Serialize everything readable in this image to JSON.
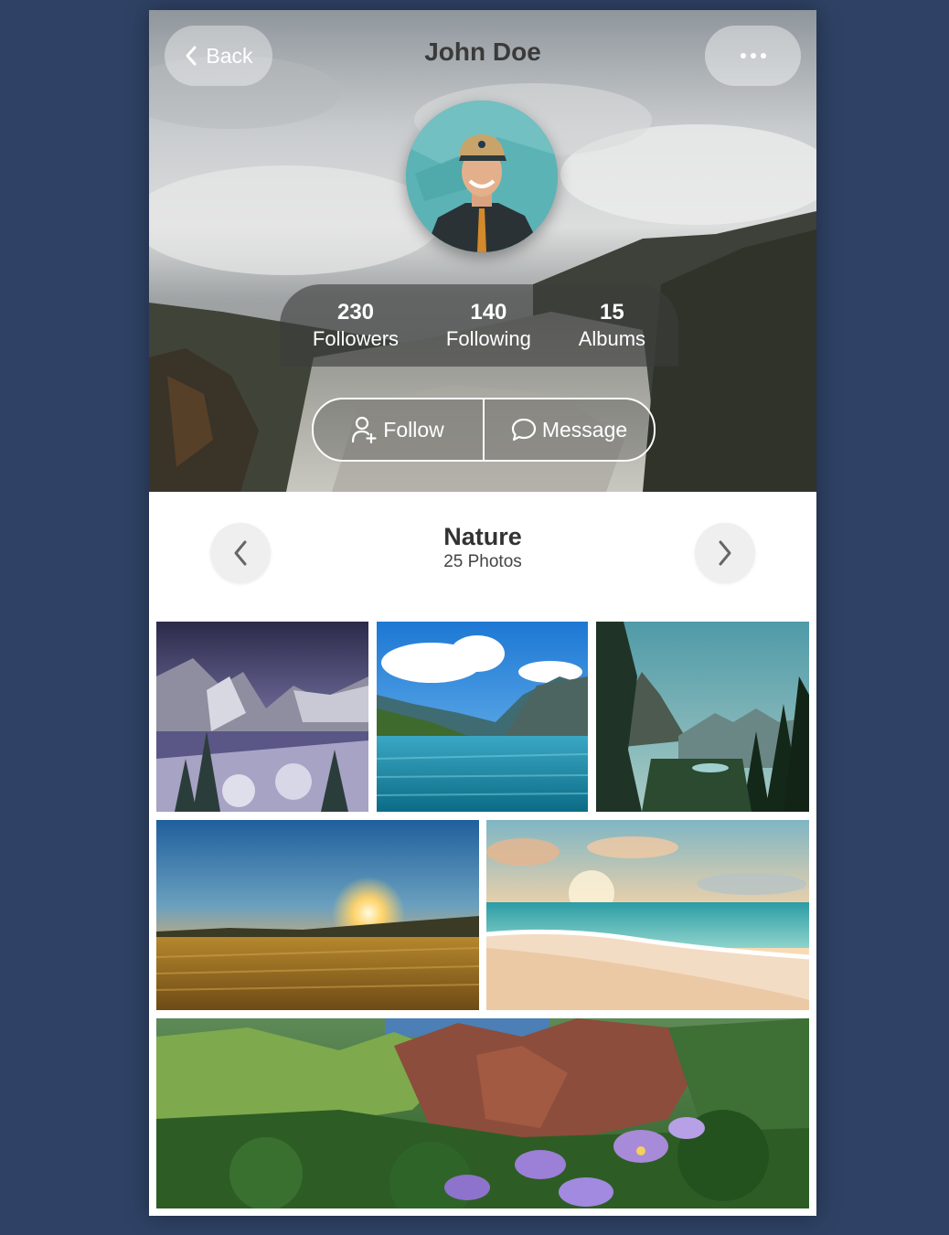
{
  "header": {
    "back_label": "Back",
    "title": "John Doe"
  },
  "stats": [
    {
      "value": "230",
      "label": "Followers"
    },
    {
      "value": "140",
      "label": "Following"
    },
    {
      "value": "15",
      "label": "Albums"
    }
  ],
  "actions": {
    "follow_label": "Follow",
    "message_label": "Message"
  },
  "album": {
    "name": "Nature",
    "count": "25 Photos"
  },
  "colors": {
    "page_background": "#2f4265",
    "card_background": "#ffffff",
    "nav_button": "#efefef"
  }
}
